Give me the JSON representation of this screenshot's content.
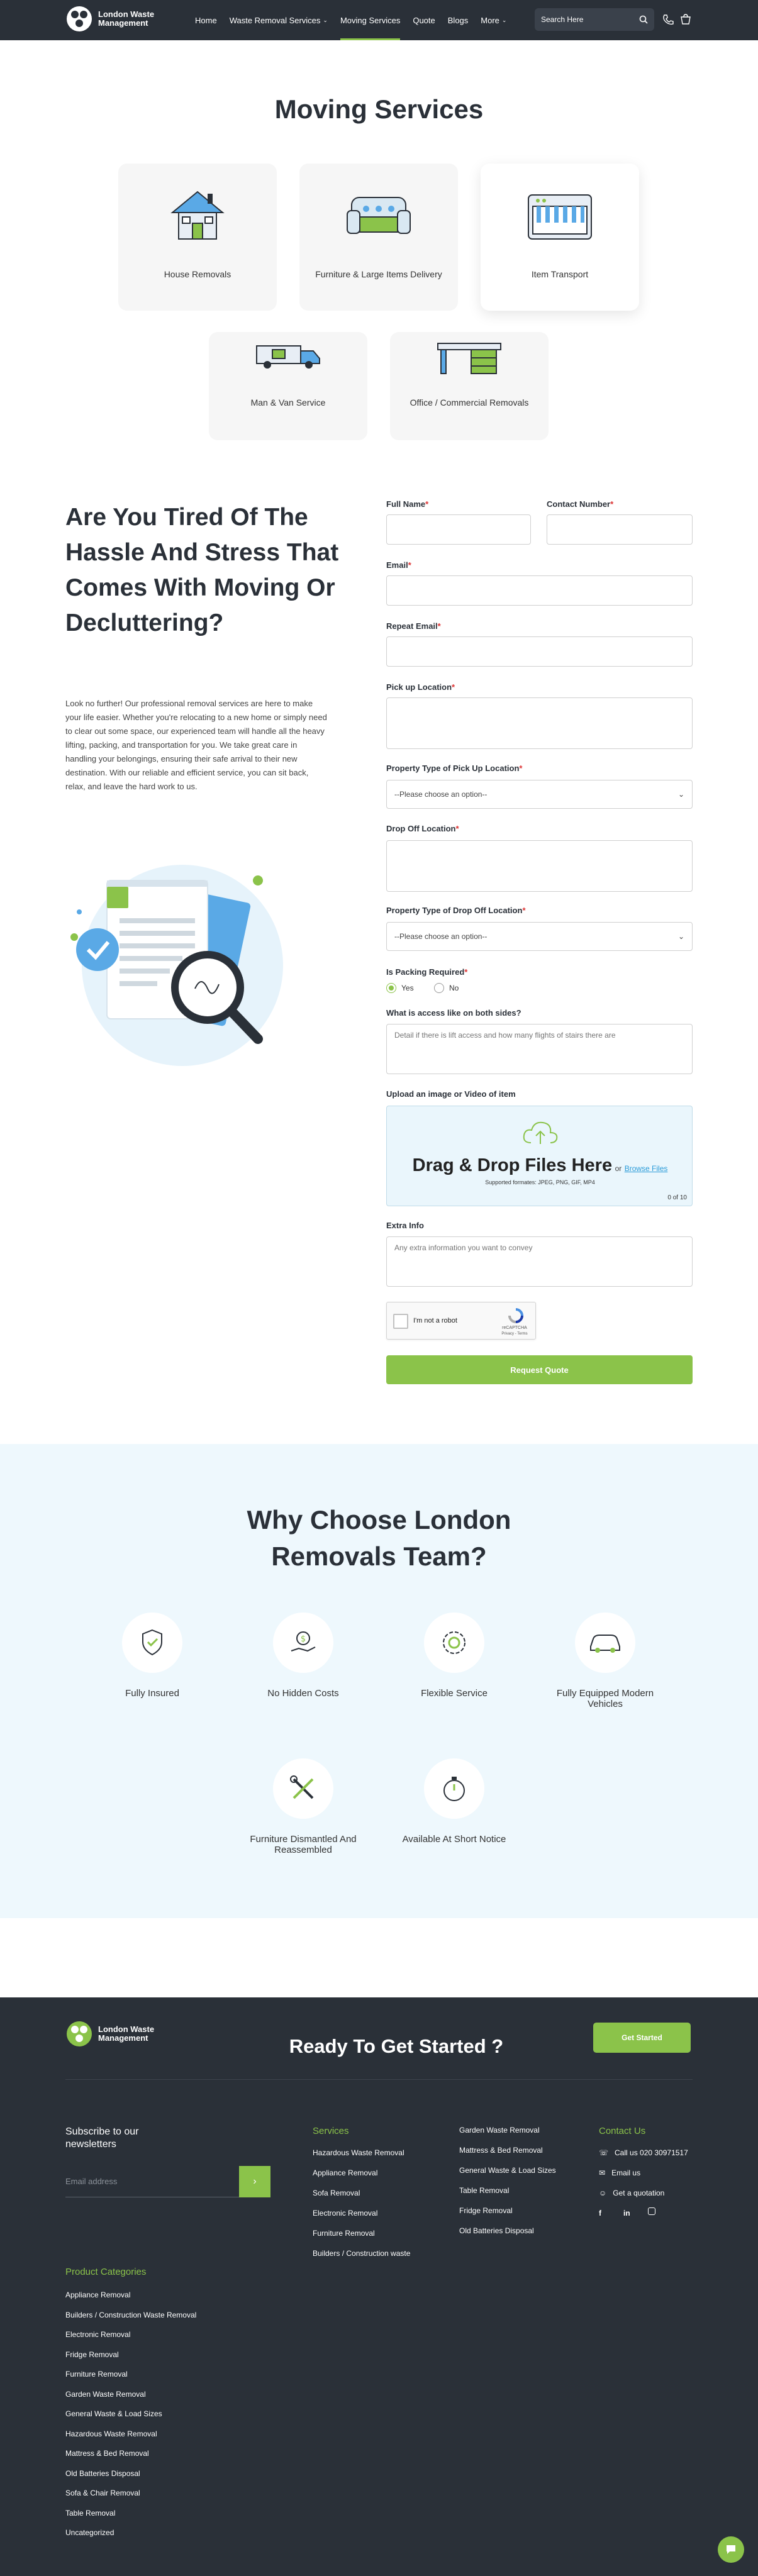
{
  "brand": {
    "line1": "London Waste",
    "line2": "Management"
  },
  "nav": {
    "items": [
      {
        "label": "Home",
        "dropdown": false
      },
      {
        "label": "Waste Removal Services",
        "dropdown": true
      },
      {
        "label": "Moving Services",
        "dropdown": false,
        "active": true
      },
      {
        "label": "Quote",
        "dropdown": false
      },
      {
        "label": "Blogs",
        "dropdown": false
      },
      {
        "label": "More",
        "dropdown": true
      }
    ],
    "search_placeholder": "Search Here"
  },
  "moving": {
    "title": "Moving Services",
    "cards": [
      {
        "label": "House Removals",
        "icon": "house-icon"
      },
      {
        "label": "Furniture & Large Items Delivery",
        "icon": "sofa-icon"
      },
      {
        "label": "Item Transport",
        "icon": "piano-icon"
      },
      {
        "label": "Man & Van Service",
        "icon": "truck-icon"
      },
      {
        "label": "Office / Commercial Removals",
        "icon": "office-desk-icon"
      }
    ]
  },
  "intro": {
    "heading": "Are You Tired Of The Hassle And Stress That Comes With Moving Or Decluttering?",
    "body": "Look no further! Our professional removal services are here to make your life easier. Whether you're relocating to a new home or simply need to clear out some space, our experienced team will handle all the heavy lifting, packing, and transportation for you. We take great care in handling your belongings, ensuring their safe arrival to their new destination. With our reliable and efficient service, you can sit back, relax, and leave the hard work to us."
  },
  "form": {
    "full_name": "Full Name",
    "contact_number": "Contact Number",
    "email": "Email",
    "repeat_email": "Repeat Email",
    "pickup": "Pick up Location",
    "pickup_property": "Property Type of Pick Up Location",
    "select_placeholder": "--Please choose an option--",
    "dropoff": "Drop Off Location",
    "dropoff_property": "Property Type of Drop Off Location",
    "packing": "Is Packing Required",
    "packing_yes": "Yes",
    "packing_no": "No",
    "access": "What is access like on both sides?",
    "access_placeholder": "Detail if there is lift access and how many flights of stairs there are",
    "upload": "Upload an image or Video of item",
    "drop_title": "Drag & Drop Files Here",
    "drop_or": "or",
    "browse": "Browse Files",
    "formats": "Supported formates: JPEG, PNG, GIF, MP4",
    "file_count": "0 of 10",
    "extra": "Extra Info",
    "extra_placeholder": "Any extra information you want to convey",
    "captcha_label": "I'm not a robot",
    "captcha_brand": "reCAPTCHA",
    "captcha_links": "Privacy - Terms",
    "submit": "Request Quote"
  },
  "why": {
    "title_line1": "Why Choose London",
    "title_line2": "Removals Team?",
    "features": [
      {
        "label": "Fully Insured",
        "icon": "shield-hand-icon"
      },
      {
        "label": "No Hidden Costs",
        "icon": "money-hand-icon"
      },
      {
        "label": "Flexible Service",
        "icon": "gear-cycle-icon"
      },
      {
        "label": "Fully Equipped Modern Vehicles",
        "icon": "car-icon"
      },
      {
        "label": "Furniture Dismantled And Reassembled",
        "icon": "tools-icon"
      },
      {
        "label": "Available At Short Notice",
        "icon": "stopwatch-icon"
      }
    ]
  },
  "footer": {
    "cta_title": "Ready To Get Started ?",
    "cta_button": "Get Started",
    "newsletter_title": "Subscribe to our newsletters",
    "newsletter_placeholder": "Email address",
    "services_head": "Services",
    "services_col1": [
      "Hazardous Waste Removal",
      "Appliance Removal",
      "Sofa Removal",
      "Electronic Removal",
      "Furniture Removal",
      "Builders / Construction waste"
    ],
    "services_col2": [
      "Garden Waste Removal",
      "Mattress & Bed Removal",
      "General Waste & Load Sizes",
      "Table Removal",
      "Fridge Removal",
      "Old Batteries Disposal"
    ],
    "contact_head": "Contact Us",
    "contact_phone": "Call us 020 30971517",
    "contact_email": "Email us",
    "contact_quote": "Get a quotation",
    "categories_head": "Product Categories",
    "categories": [
      "Appliance Removal",
      "Builders / Construction Waste Removal",
      "Electronic Removal",
      "Fridge Removal",
      "Furniture Removal",
      "Garden Waste Removal",
      "General Waste & Load Sizes",
      "Hazardous Waste Removal",
      "Mattress & Bed Removal",
      "Old Batteries Disposal",
      "Sofa & Chair Removal",
      "Table Removal",
      "Uncategorized"
    ]
  },
  "colors": {
    "accent": "#8bc34a",
    "dark": "#2a3038",
    "light_blue": "#eef8fd"
  }
}
